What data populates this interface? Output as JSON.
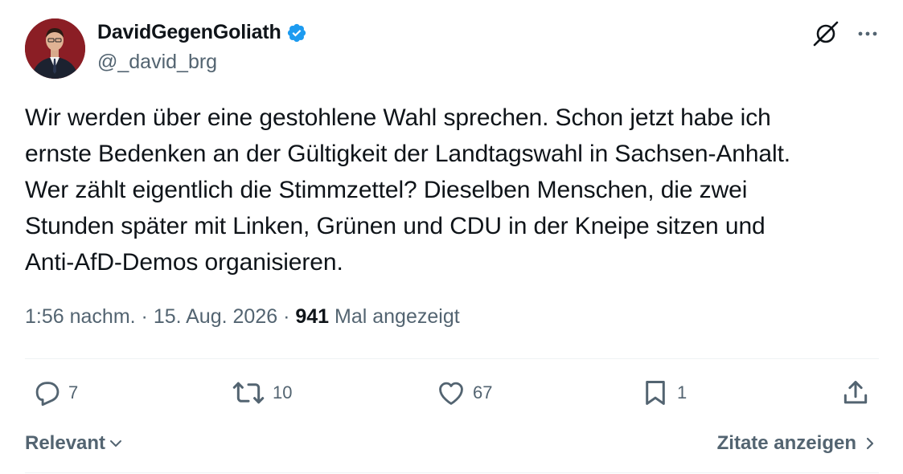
{
  "author": {
    "display_name": "DavidGegenGoliath",
    "handle": "@_david_brg",
    "verified": true,
    "verified_color": "#1d9bf0"
  },
  "tweet": {
    "text": "Wir werden über eine gestohlene Wahl sprechen. Schon jetzt habe ich\nernste Bedenken an der Gültigkeit der Landtagswahl in Sachsen-Anhalt.\nWer zählt eigentlich die Stimmzettel? Dieselben Menschen, die zwei\nStunden später mit Linken, Grünen und CDU in der Kneipe sitzen und\nAnti-AfD-Demos organisieren.",
    "time": "1:56 nachm.",
    "separator": " · ",
    "date": "15. Aug. 2026",
    "views_count": "941",
    "views_label": "Mal angezeigt"
  },
  "actions": {
    "replies": "7",
    "reposts": "10",
    "likes": "67",
    "bookmarks": "1"
  },
  "footer": {
    "sort_label": "Relevant",
    "quotes_label": "Zitate anzeigen"
  },
  "icons": {
    "top": [
      "grok-icon",
      "more-icon"
    ],
    "actions": [
      "reply-icon",
      "repost-icon",
      "like-icon",
      "bookmark-icon",
      "share-icon"
    ]
  },
  "colors": {
    "text": "#0f1419",
    "secondary": "#536471",
    "divider": "#eff3f4"
  }
}
